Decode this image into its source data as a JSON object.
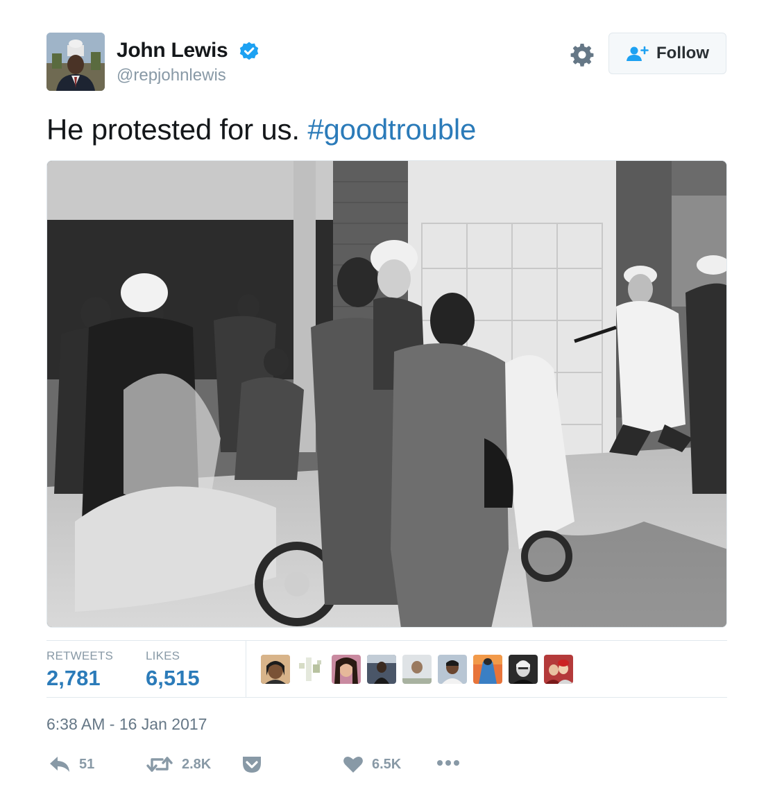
{
  "author": {
    "name": "John Lewis",
    "handle": "@repjohnlewis",
    "verified": true,
    "avatar_icon": "profile-photo"
  },
  "header": {
    "settings_icon": "gear-icon",
    "follow_label": "Follow",
    "follow_icon": "add-user-icon"
  },
  "tweet": {
    "text": "He protested for us.",
    "hashtag": "#goodtrouble",
    "timestamp": "6:38 AM - 16 Jan 2017"
  },
  "stats": {
    "retweets_label": "RETWEETS",
    "retweets_value": "2,781",
    "likes_label": "LIKES",
    "likes_value": "6,515"
  },
  "likers": [
    {
      "name": "liker-avatar-1"
    },
    {
      "name": "liker-avatar-2"
    },
    {
      "name": "liker-avatar-3"
    },
    {
      "name": "liker-avatar-4"
    },
    {
      "name": "liker-avatar-5"
    },
    {
      "name": "liker-avatar-6"
    },
    {
      "name": "liker-avatar-7"
    },
    {
      "name": "liker-avatar-8"
    },
    {
      "name": "liker-avatar-9"
    }
  ],
  "actions": {
    "reply_count": "51",
    "retweet_count": "2.8K",
    "like_count": "6.5K"
  },
  "colors": {
    "link": "#2b7bb9",
    "muted": "#8899a6",
    "verified": "#1da1f2",
    "border": "#e1e8ed"
  }
}
